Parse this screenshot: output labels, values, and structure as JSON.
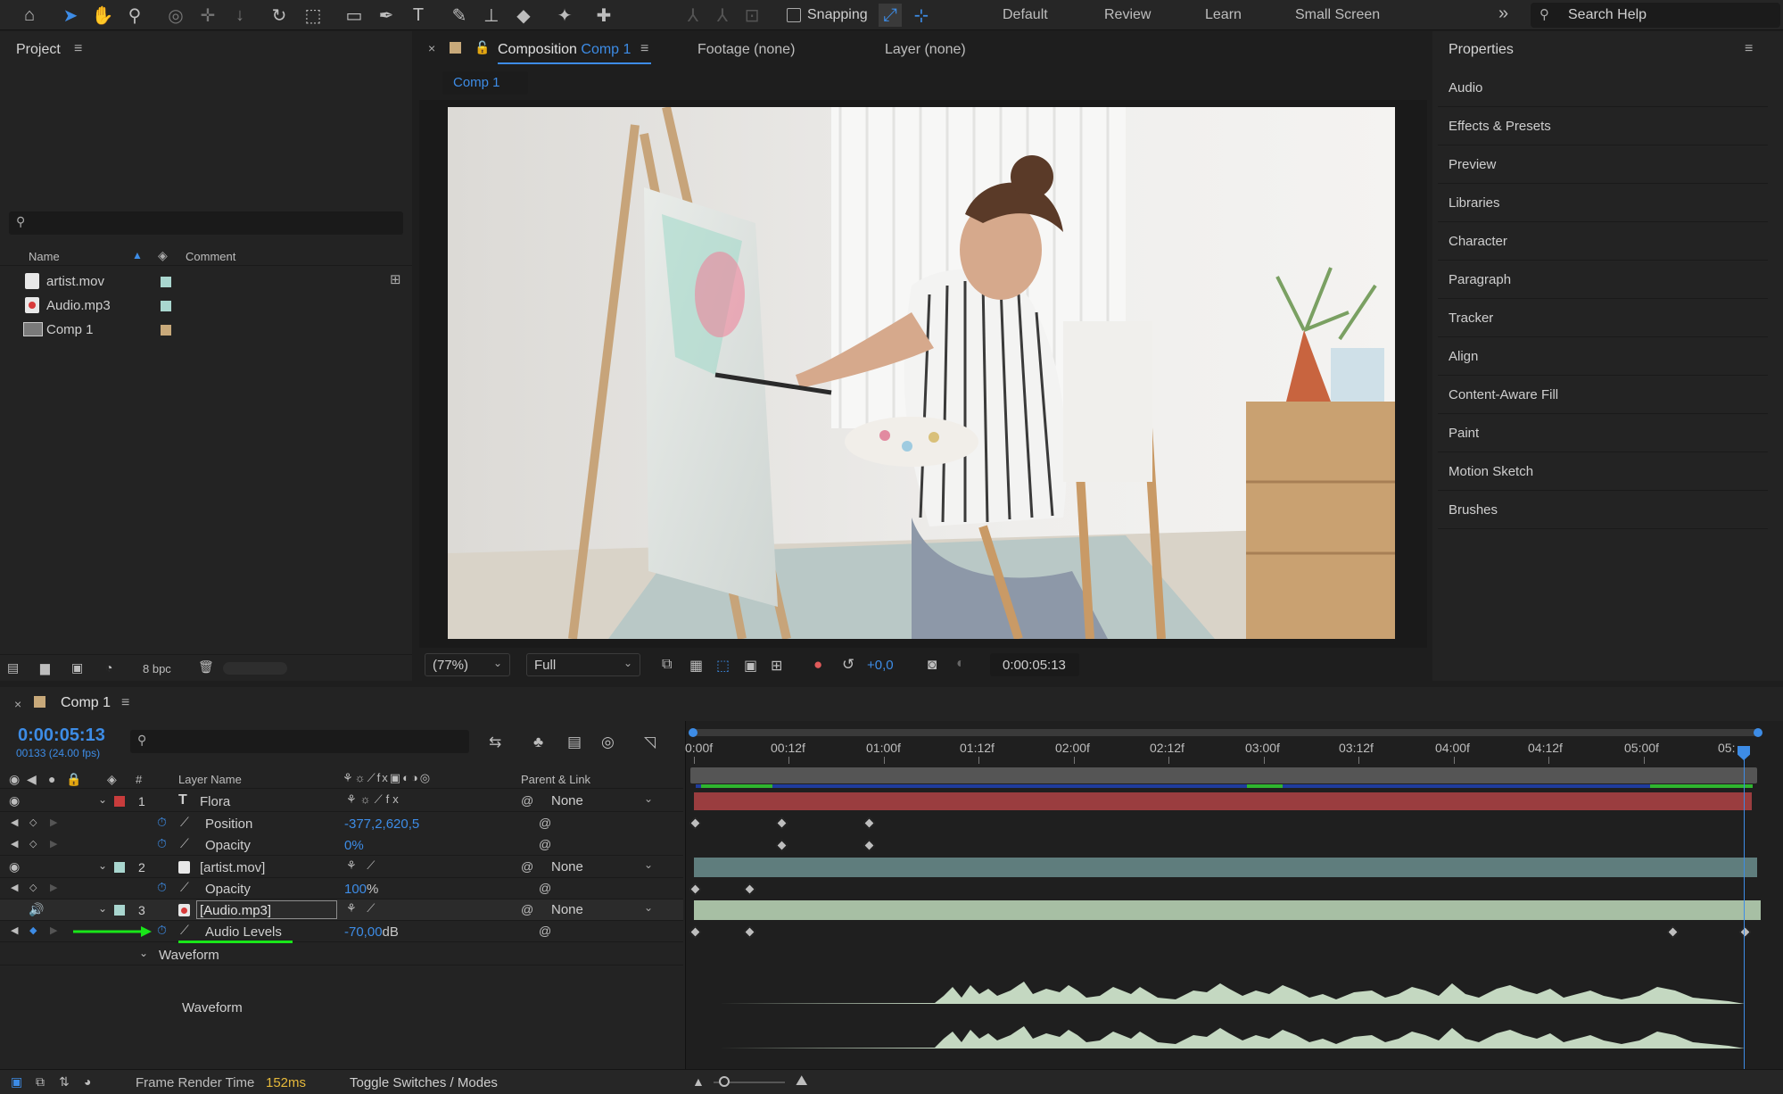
{
  "toolbar": {
    "snapping_label": "Snapping",
    "workspaces": [
      "Default",
      "Review",
      "Learn",
      "Small Screen"
    ],
    "more_glyph": "»",
    "search_placeholder": "Search Help"
  },
  "project": {
    "title": "Project",
    "columns": {
      "name": "Name",
      "comment": "Comment"
    },
    "items": [
      {
        "name": "artist.mov",
        "color": "#a9d6cf"
      },
      {
        "name": "Audio.mp3",
        "color": "#a9d6cf"
      },
      {
        "name": "Comp 1",
        "color": "#c8a97a"
      }
    ],
    "bpc": "8 bpc"
  },
  "composition": {
    "tab_prefix": "Composition",
    "tab_name": "Comp 1",
    "footage_tab": "Footage (none)",
    "layer_tab": "Layer (none)",
    "comp_chip": "Comp 1",
    "zoom": "(77%)",
    "resolution": "Full",
    "exposure": "+0,0",
    "timecode": "0:00:05:13"
  },
  "properties": {
    "title": "Properties",
    "items": [
      "Audio",
      "Effects & Presets",
      "Preview",
      "Libraries",
      "Character",
      "Paragraph",
      "Tracker",
      "Align",
      "Content-Aware Fill",
      "Paint",
      "Motion Sketch",
      "Brushes"
    ]
  },
  "timeline": {
    "comp_name": "Comp 1",
    "timecode": "0:00:05:13",
    "frame_info": "00133 (24.00 fps)",
    "ruler": [
      "0:00f",
      "00:12f",
      "01:00f",
      "01:12f",
      "02:00f",
      "02:12f",
      "03:00f",
      "03:12f",
      "04:00f",
      "04:12f",
      "05:00f",
      "05:"
    ],
    "columns": {
      "hash": "#",
      "layer_name": "Layer Name",
      "parent": "Parent & Link"
    },
    "layers": [
      {
        "num": "1",
        "name": "Flora",
        "parent": "None",
        "color": "#c83c3c"
      },
      {
        "num": "2",
        "name": "[artist.mov]",
        "parent": "None",
        "color": "#a9d6cf"
      },
      {
        "num": "3",
        "name": "[Audio.mp3]",
        "parent": "None",
        "color": "#a9d6cf"
      }
    ],
    "props": {
      "flora_position": {
        "name": "Position",
        "value": "-377,2,620,5"
      },
      "flora_opacity": {
        "name": "Opacity",
        "value": "0%"
      },
      "artist_opacity": {
        "name": "Opacity",
        "value": "100",
        "unit": "%"
      },
      "audio_levels": {
        "name": "Audio Levels",
        "value": "-70,00",
        "unit": "dB"
      }
    },
    "waveform_group": "Waveform",
    "waveform_label": "Waveform",
    "footer": {
      "render_label": "Frame Render Time",
      "render_value": "152ms",
      "toggle": "Toggle Switches / Modes"
    }
  },
  "colors": {
    "accent": "#3d8ce6",
    "flora_bar": "#9a3d3f",
    "artist_bar": "#5f7d7d",
    "audio_bar": "#a7bfa4",
    "waveform": "#c4d8c1",
    "arrow": "#19e619"
  }
}
